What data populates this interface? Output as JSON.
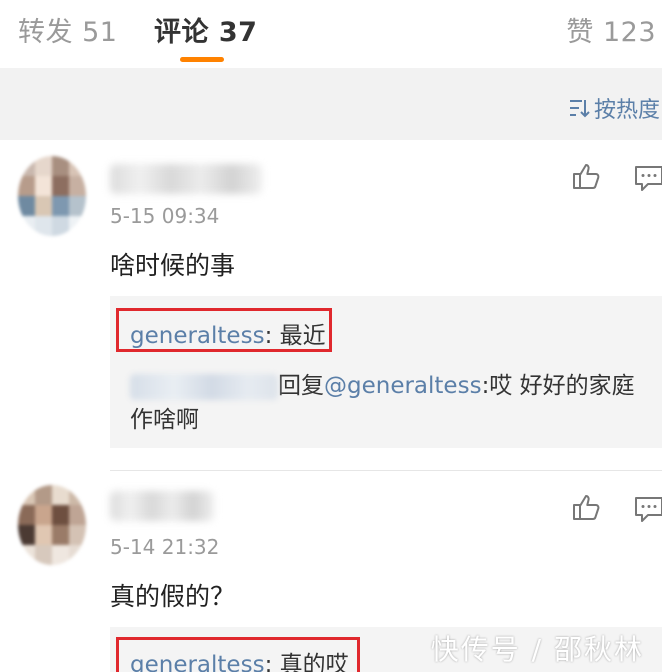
{
  "tabs": [
    {
      "label": "转发 51",
      "active": false
    },
    {
      "label": "评论 37",
      "active": true
    },
    {
      "label": "赞 123",
      "active": false
    }
  ],
  "sort": {
    "label": "按热度",
    "icon": "sort-icon"
  },
  "comments": [
    {
      "time": "5-15 09:34",
      "text": "啥时候的事",
      "replies": {
        "top": {
          "handle": "generaltess",
          "text": ": 最近"
        },
        "second": {
          "prefix": "回复",
          "handle": "@generaltess",
          "text": ":哎 好好的家庭",
          "text2": "作啥啊"
        }
      }
    },
    {
      "time": "5-14 21:32",
      "text": "真的假的？",
      "replies": {
        "top": {
          "handle": "generaltess",
          "text": ": 真的哎"
        }
      }
    }
  ],
  "watermark": "快传号 / 邵秋林",
  "colors": {
    "accent": "#ff8200",
    "link": "#5b7fa8",
    "highlight_box": "#e0282d"
  }
}
